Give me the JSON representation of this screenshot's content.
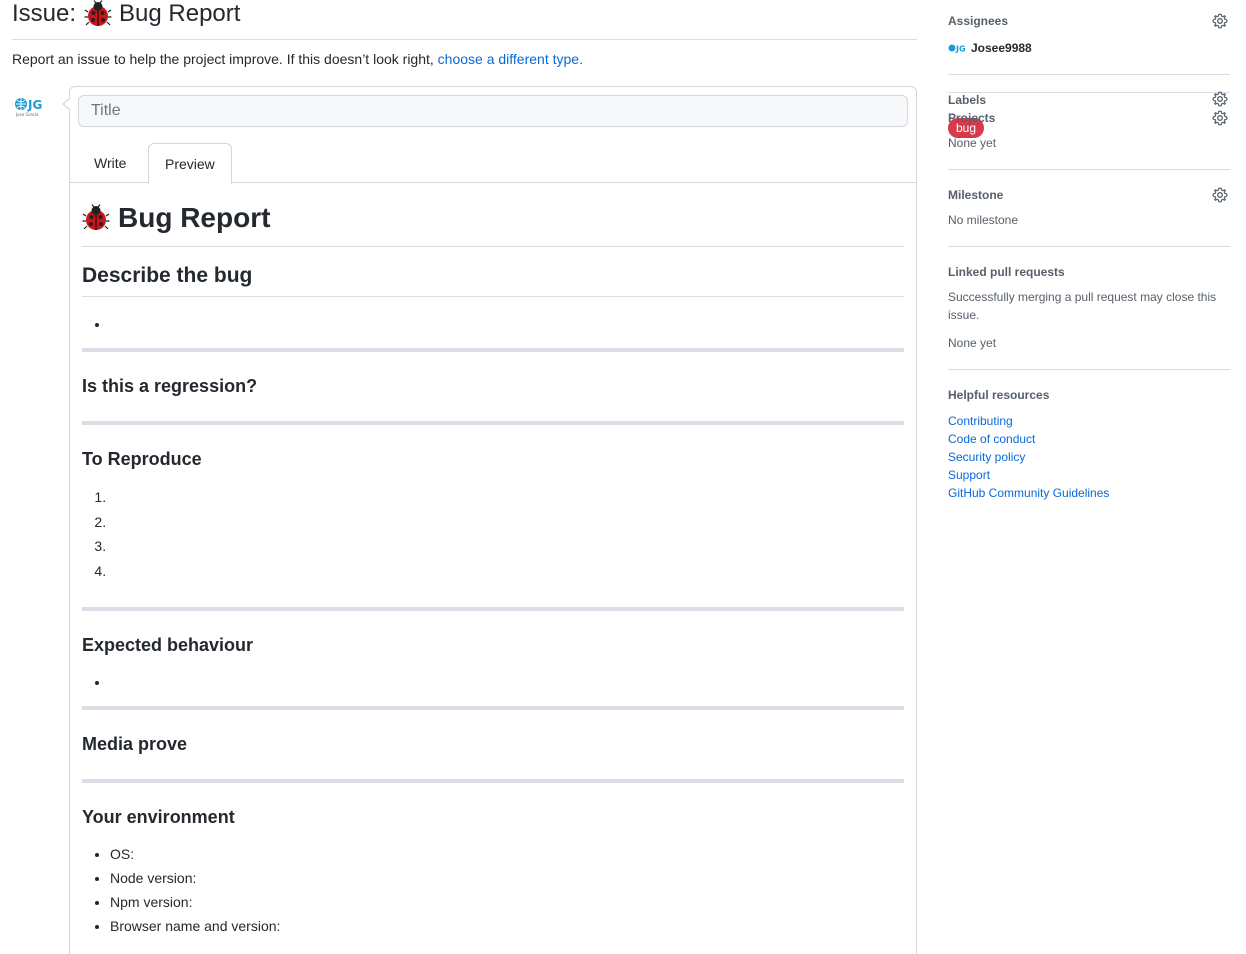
{
  "page": {
    "title_prefix": "Issue:",
    "title_text": "Bug Report",
    "subtitle": "Report an issue to help the project improve. If this doesn’t look right, ",
    "subtitle_link": "choose a different type."
  },
  "editor": {
    "title_placeholder": "Title",
    "tabs": {
      "write": "Write",
      "preview": "Preview"
    }
  },
  "preview": {
    "heading": "Bug Report",
    "describe": "Describe the bug",
    "regression": "Is this a regression?",
    "reproduce": "To Reproduce",
    "expected": "Expected behaviour",
    "media": "Media prove",
    "environment": "Your environment",
    "env_items": [
      "OS:",
      "Node version:",
      "Npm version:",
      "Browser name and version:"
    ]
  },
  "sidebar": {
    "assignees": {
      "label": "Assignees",
      "user": "Josee9988"
    },
    "labels": {
      "label": "Labels",
      "bug": "bug",
      "bug_color": "#d73a4a"
    },
    "projects": {
      "label": "Projects",
      "value": "None yet"
    },
    "milestone": {
      "label": "Milestone",
      "value": "No milestone"
    },
    "linked": {
      "label": "Linked pull requests",
      "desc": "Successfully merging a pull request may close this issue.",
      "value": "None yet"
    },
    "resources": {
      "label": "Helpful resources",
      "links": [
        "Contributing",
        "Code of conduct",
        "Security policy",
        "Support",
        "GitHub Community Guidelines"
      ]
    }
  },
  "colors": {
    "link": "#0969da",
    "border": "#d0d7de",
    "text": "#24292f",
    "muted": "#57606a"
  }
}
